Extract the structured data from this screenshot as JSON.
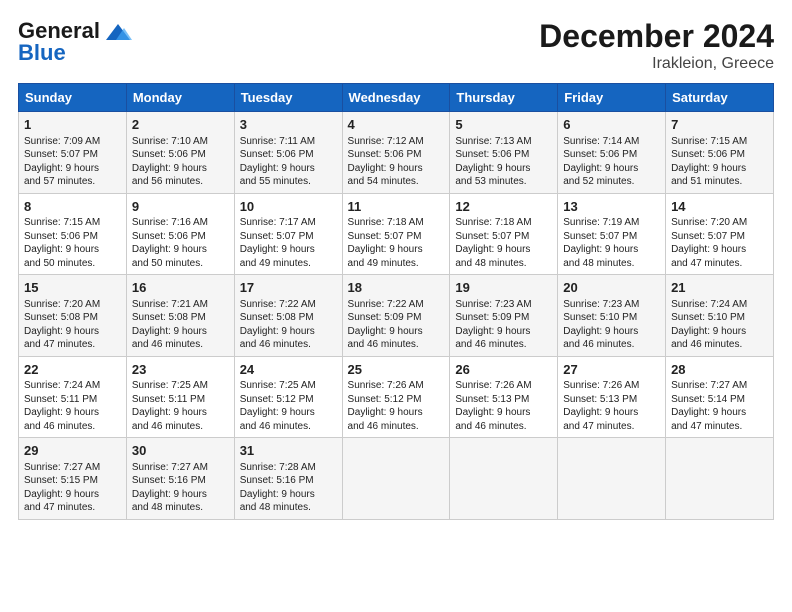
{
  "header": {
    "logo_general": "General",
    "logo_blue": "Blue",
    "title": "December 2024",
    "subtitle": "Irakleion, Greece"
  },
  "columns": [
    "Sunday",
    "Monday",
    "Tuesday",
    "Wednesday",
    "Thursday",
    "Friday",
    "Saturday"
  ],
  "weeks": [
    [
      {
        "day": "1",
        "lines": [
          "Sunrise: 7:09 AM",
          "Sunset: 5:07 PM",
          "Daylight: 9 hours",
          "and 57 minutes."
        ]
      },
      {
        "day": "2",
        "lines": [
          "Sunrise: 7:10 AM",
          "Sunset: 5:06 PM",
          "Daylight: 9 hours",
          "and 56 minutes."
        ]
      },
      {
        "day": "3",
        "lines": [
          "Sunrise: 7:11 AM",
          "Sunset: 5:06 PM",
          "Daylight: 9 hours",
          "and 55 minutes."
        ]
      },
      {
        "day": "4",
        "lines": [
          "Sunrise: 7:12 AM",
          "Sunset: 5:06 PM",
          "Daylight: 9 hours",
          "and 54 minutes."
        ]
      },
      {
        "day": "5",
        "lines": [
          "Sunrise: 7:13 AM",
          "Sunset: 5:06 PM",
          "Daylight: 9 hours",
          "and 53 minutes."
        ]
      },
      {
        "day": "6",
        "lines": [
          "Sunrise: 7:14 AM",
          "Sunset: 5:06 PM",
          "Daylight: 9 hours",
          "and 52 minutes."
        ]
      },
      {
        "day": "7",
        "lines": [
          "Sunrise: 7:15 AM",
          "Sunset: 5:06 PM",
          "Daylight: 9 hours",
          "and 51 minutes."
        ]
      }
    ],
    [
      {
        "day": "8",
        "lines": [
          "Sunrise: 7:15 AM",
          "Sunset: 5:06 PM",
          "Daylight: 9 hours",
          "and 50 minutes."
        ]
      },
      {
        "day": "9",
        "lines": [
          "Sunrise: 7:16 AM",
          "Sunset: 5:06 PM",
          "Daylight: 9 hours",
          "and 50 minutes."
        ]
      },
      {
        "day": "10",
        "lines": [
          "Sunrise: 7:17 AM",
          "Sunset: 5:07 PM",
          "Daylight: 9 hours",
          "and 49 minutes."
        ]
      },
      {
        "day": "11",
        "lines": [
          "Sunrise: 7:18 AM",
          "Sunset: 5:07 PM",
          "Daylight: 9 hours",
          "and 49 minutes."
        ]
      },
      {
        "day": "12",
        "lines": [
          "Sunrise: 7:18 AM",
          "Sunset: 5:07 PM",
          "Daylight: 9 hours",
          "and 48 minutes."
        ]
      },
      {
        "day": "13",
        "lines": [
          "Sunrise: 7:19 AM",
          "Sunset: 5:07 PM",
          "Daylight: 9 hours",
          "and 48 minutes."
        ]
      },
      {
        "day": "14",
        "lines": [
          "Sunrise: 7:20 AM",
          "Sunset: 5:07 PM",
          "Daylight: 9 hours",
          "and 47 minutes."
        ]
      }
    ],
    [
      {
        "day": "15",
        "lines": [
          "Sunrise: 7:20 AM",
          "Sunset: 5:08 PM",
          "Daylight: 9 hours",
          "and 47 minutes."
        ]
      },
      {
        "day": "16",
        "lines": [
          "Sunrise: 7:21 AM",
          "Sunset: 5:08 PM",
          "Daylight: 9 hours",
          "and 46 minutes."
        ]
      },
      {
        "day": "17",
        "lines": [
          "Sunrise: 7:22 AM",
          "Sunset: 5:08 PM",
          "Daylight: 9 hours",
          "and 46 minutes."
        ]
      },
      {
        "day": "18",
        "lines": [
          "Sunrise: 7:22 AM",
          "Sunset: 5:09 PM",
          "Daylight: 9 hours",
          "and 46 minutes."
        ]
      },
      {
        "day": "19",
        "lines": [
          "Sunrise: 7:23 AM",
          "Sunset: 5:09 PM",
          "Daylight: 9 hours",
          "and 46 minutes."
        ]
      },
      {
        "day": "20",
        "lines": [
          "Sunrise: 7:23 AM",
          "Sunset: 5:10 PM",
          "Daylight: 9 hours",
          "and 46 minutes."
        ]
      },
      {
        "day": "21",
        "lines": [
          "Sunrise: 7:24 AM",
          "Sunset: 5:10 PM",
          "Daylight: 9 hours",
          "and 46 minutes."
        ]
      }
    ],
    [
      {
        "day": "22",
        "lines": [
          "Sunrise: 7:24 AM",
          "Sunset: 5:11 PM",
          "Daylight: 9 hours",
          "and 46 minutes."
        ]
      },
      {
        "day": "23",
        "lines": [
          "Sunrise: 7:25 AM",
          "Sunset: 5:11 PM",
          "Daylight: 9 hours",
          "and 46 minutes."
        ]
      },
      {
        "day": "24",
        "lines": [
          "Sunrise: 7:25 AM",
          "Sunset: 5:12 PM",
          "Daylight: 9 hours",
          "and 46 minutes."
        ]
      },
      {
        "day": "25",
        "lines": [
          "Sunrise: 7:26 AM",
          "Sunset: 5:12 PM",
          "Daylight: 9 hours",
          "and 46 minutes."
        ]
      },
      {
        "day": "26",
        "lines": [
          "Sunrise: 7:26 AM",
          "Sunset: 5:13 PM",
          "Daylight: 9 hours",
          "and 46 minutes."
        ]
      },
      {
        "day": "27",
        "lines": [
          "Sunrise: 7:26 AM",
          "Sunset: 5:13 PM",
          "Daylight: 9 hours",
          "and 47 minutes."
        ]
      },
      {
        "day": "28",
        "lines": [
          "Sunrise: 7:27 AM",
          "Sunset: 5:14 PM",
          "Daylight: 9 hours",
          "and 47 minutes."
        ]
      }
    ],
    [
      {
        "day": "29",
        "lines": [
          "Sunrise: 7:27 AM",
          "Sunset: 5:15 PM",
          "Daylight: 9 hours",
          "and 47 minutes."
        ]
      },
      {
        "day": "30",
        "lines": [
          "Sunrise: 7:27 AM",
          "Sunset: 5:16 PM",
          "Daylight: 9 hours",
          "and 48 minutes."
        ]
      },
      {
        "day": "31",
        "lines": [
          "Sunrise: 7:28 AM",
          "Sunset: 5:16 PM",
          "Daylight: 9 hours",
          "and 48 minutes."
        ]
      },
      null,
      null,
      null,
      null
    ]
  ]
}
